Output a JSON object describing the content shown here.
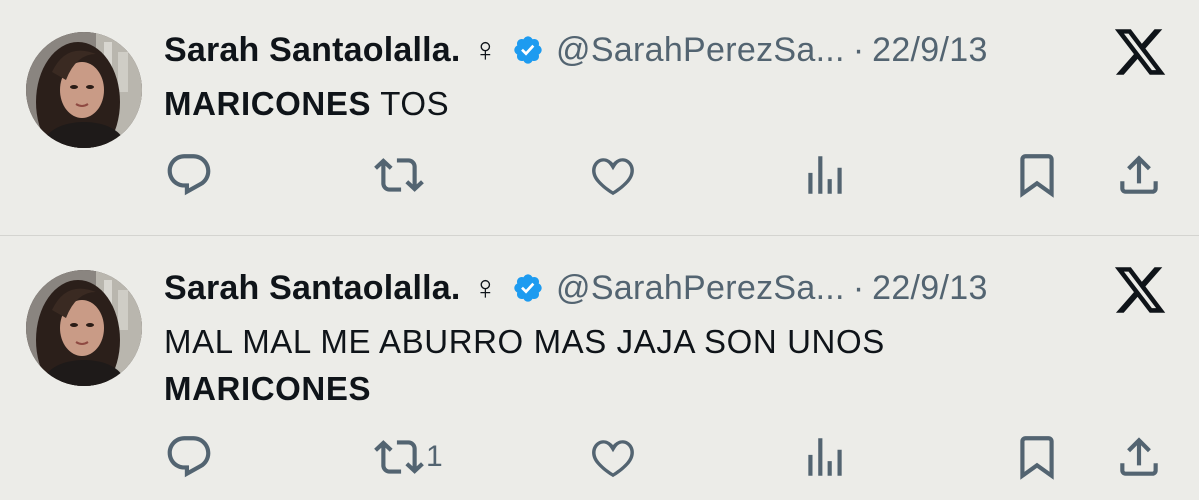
{
  "tweets": [
    {
      "author_name": "Sarah Santaolalla.",
      "gender_symbol": "♀",
      "handle": "@SarahPerezSa...",
      "separator": "·",
      "date": "22/9/13",
      "text_parts": [
        {
          "text": "MARICONES",
          "bold": true
        },
        {
          "text": " TOS",
          "bold": false
        }
      ],
      "retweet_count": ""
    },
    {
      "author_name": "Sarah Santaolalla.",
      "gender_symbol": "♀",
      "handle": "@SarahPerezSa...",
      "separator": "·",
      "date": "22/9/13",
      "text_parts": [
        {
          "text": "MAL MAL ME ABURRO MAS JAJA SON UNOS ",
          "bold": false
        },
        {
          "text": "MARICONES",
          "bold": true
        }
      ],
      "retweet_count": "1"
    }
  ],
  "icons": {
    "verified": "verified-badge-icon",
    "platform": "x-logo-icon",
    "reply": "reply-icon",
    "retweet": "retweet-icon",
    "like": "heart-icon",
    "views": "views-icon",
    "bookmark": "bookmark-icon",
    "share": "share-icon"
  },
  "colors": {
    "background": "#ecece8",
    "text": "#0f1419",
    "secondary": "#536471",
    "verified": "#1d9bf0"
  }
}
